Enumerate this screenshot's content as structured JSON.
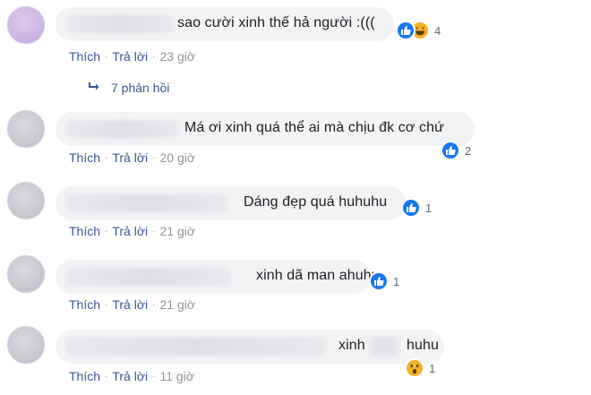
{
  "comments": [
    {
      "text": "sao cười xinh thế hả người :(((",
      "reactions": [
        "like",
        "haha"
      ],
      "reaction_count": "4",
      "like_label": "Thích",
      "reply_label": "Trả lời",
      "time": "23 giờ",
      "replies_label": "7 phản hồi"
    },
    {
      "text": "Má ơi xinh quá thể ai mà chịu đk cơ chứ",
      "reactions": [
        "like"
      ],
      "reaction_count": "2",
      "like_label": "Thích",
      "reply_label": "Trả lời",
      "time": "20 giờ"
    },
    {
      "text": "Dáng đẹp quá huhuhu",
      "reactions": [
        "like"
      ],
      "reaction_count": "1",
      "like_label": "Thích",
      "reply_label": "Trả lời",
      "time": "21 giờ"
    },
    {
      "text": "xinh dã man ahuhu",
      "reactions": [
        "like"
      ],
      "reaction_count": "1",
      "like_label": "Thích",
      "reply_label": "Trả lời",
      "time": "21 giờ"
    },
    {
      "text_a": "xinh",
      "text_b": "huhu",
      "reactions": [
        "wow"
      ],
      "reaction_count": "1",
      "like_label": "Thích",
      "reply_label": "Trả lời",
      "time": "11 giờ"
    }
  ],
  "colors": {
    "link": "#385898",
    "meta": "#90949c",
    "bubble": "#f2f3f5",
    "like": "#1877f2",
    "emoji": "#f7b125"
  }
}
